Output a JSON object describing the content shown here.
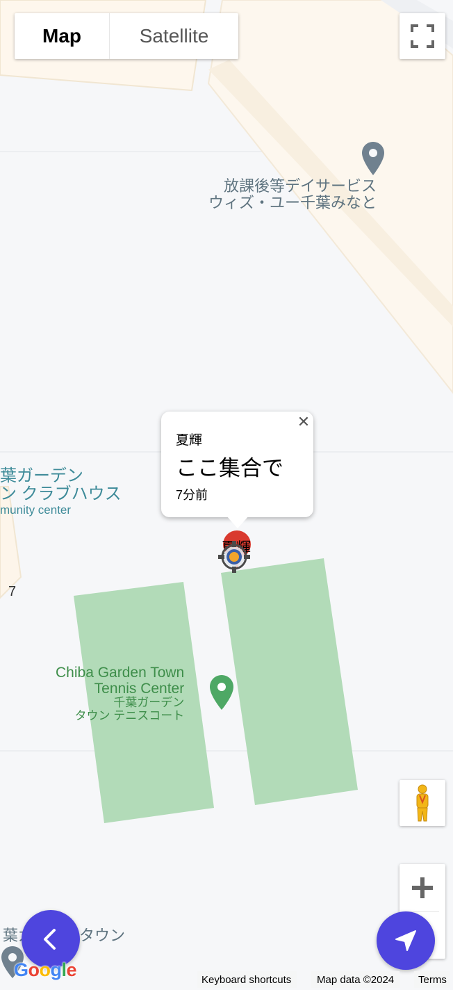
{
  "map_type": {
    "map_label": "Map",
    "satellite_label": "Satellite",
    "selected": "Map"
  },
  "labels": {
    "poi_top_line1": "放課後等デイサービス",
    "poi_top_line2": "ウィズ・ユー千葉みなと",
    "poi_left_line1": "葉ガーデン",
    "poi_left_line2": "ン クラブハウス",
    "poi_left_line3": "munity center",
    "poi_tennis_line1": "Chiba Garden Town",
    "poi_tennis_line2": "Tennis Center",
    "poi_tennis_line3": "千葉ガーデン",
    "poi_tennis_line4": "タウン テニスコート",
    "poi_bottom": "葉ガ　　ンタウン",
    "left_number": "7"
  },
  "info_window": {
    "name": "夏輝",
    "message": "ここ集合で",
    "time": "7分前",
    "close_glyph": "✕"
  },
  "marker": {
    "label": "夏輝"
  },
  "attribution": {
    "keyboard": "Keyboard shortcuts",
    "map_data": "Map data ©2024",
    "terms": "Terms"
  },
  "logo": {
    "g1": "G",
    "o1": "o",
    "o2": "o",
    "g2": "g",
    "l": "l",
    "e": "e"
  },
  "colors": {
    "accent": "#4e45de",
    "park_green": "#b2dbb8",
    "building": "#fef8ee",
    "building_edge": "#f5ebd9",
    "marker_red": "#d93a2f"
  },
  "icons": {
    "fullscreen": "fullscreen-icon",
    "pegman": "pegman-icon",
    "zoom_in": "plus-icon",
    "back": "chevron-left-icon",
    "navigate": "navigation-arrow-icon",
    "location": "crosshair-location-icon"
  }
}
